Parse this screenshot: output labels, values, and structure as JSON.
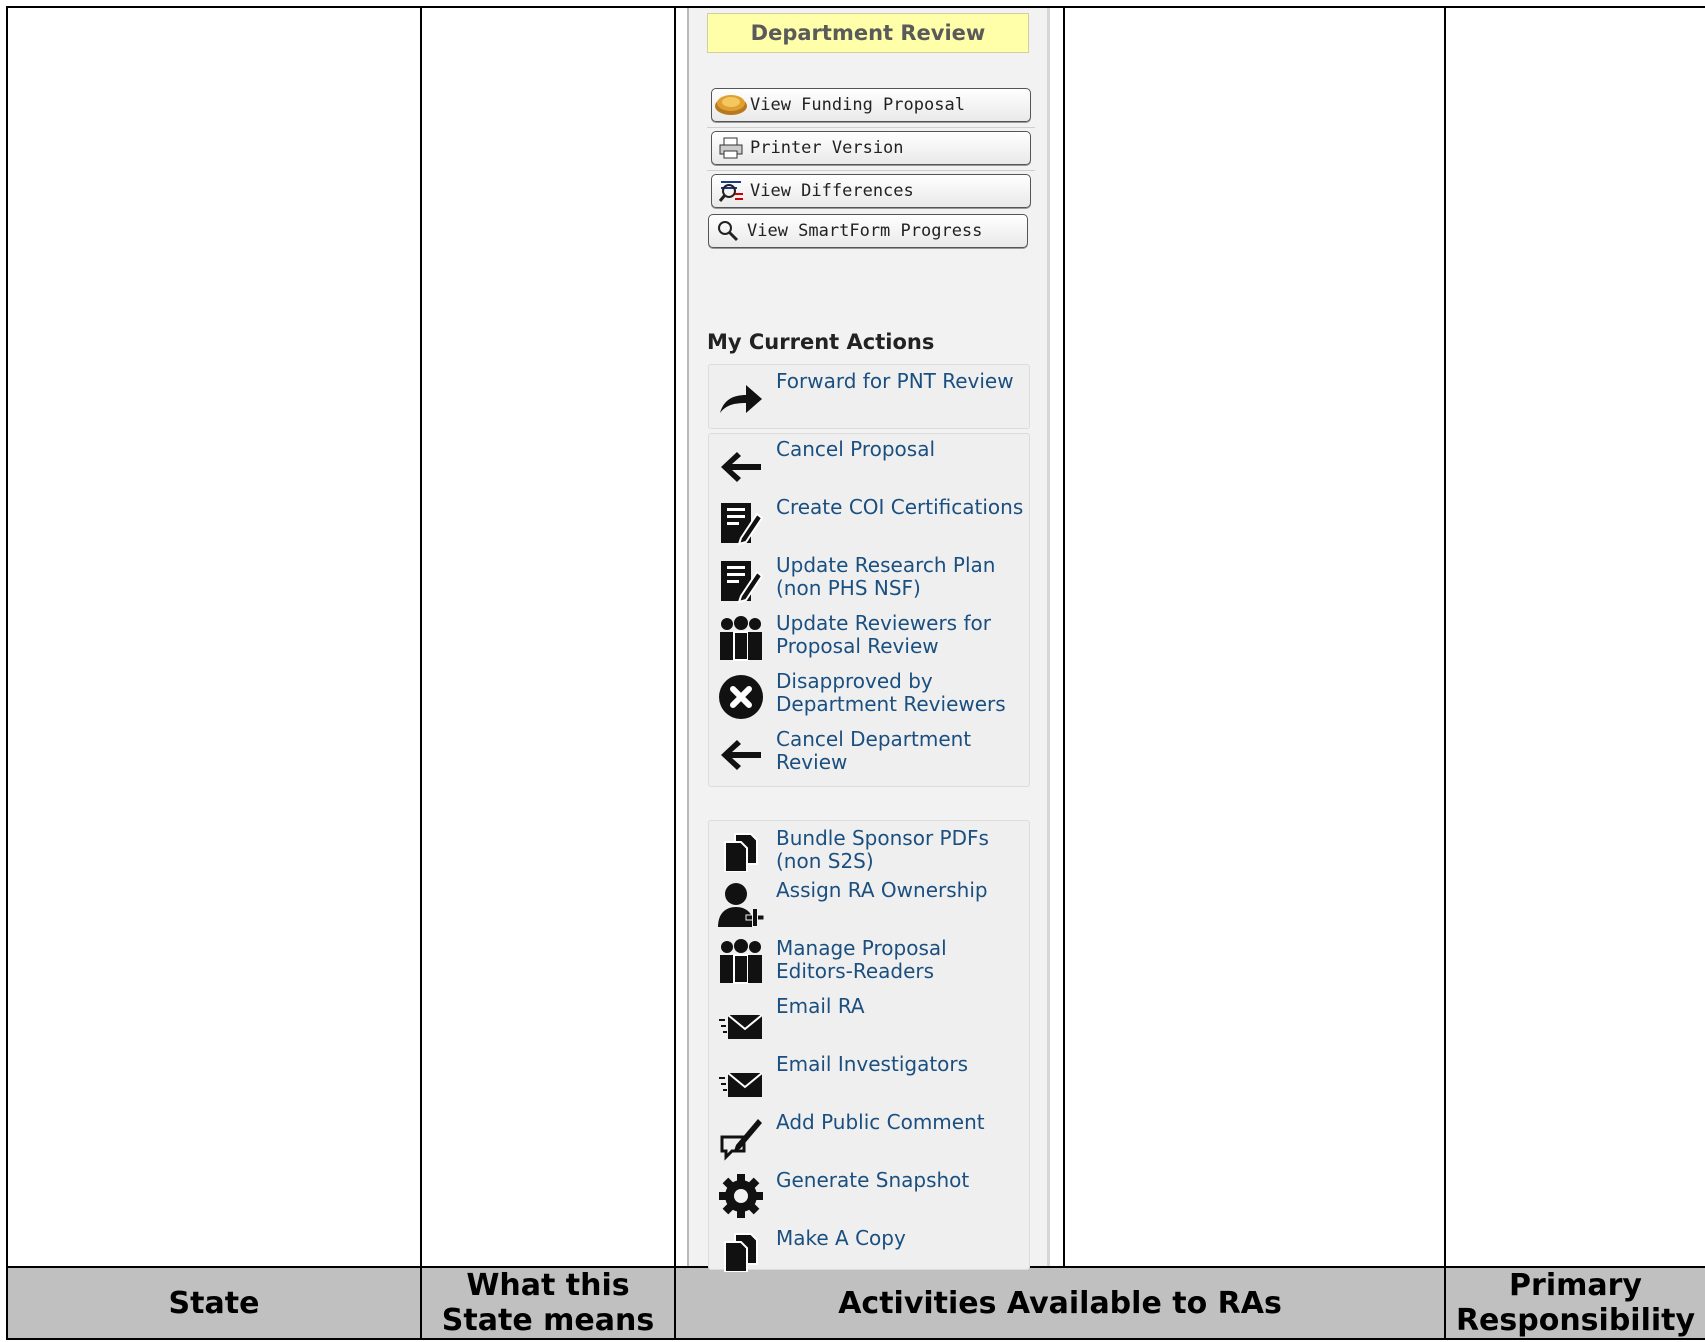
{
  "table": {
    "headers": {
      "state": "State",
      "what_means": "What this State means",
      "activities": "Activities Available to RAs",
      "primary": "Primary Responsibility"
    }
  },
  "panel": {
    "state_title": "Department Review",
    "buttons": [
      {
        "label": "View Funding Proposal",
        "icon": "coins-icon"
      },
      {
        "label": "Printer Version",
        "icon": "printer-icon"
      },
      {
        "label": "View Differences",
        "icon": "differences-icon"
      },
      {
        "label": "View SmartForm Progress",
        "icon": "magnifier-icon"
      }
    ],
    "section_title": "My Current Actions",
    "actions": [
      {
        "label": "Forward for PNT Review",
        "icon": "forward-arrow-icon"
      },
      {
        "label": "Cancel Proposal",
        "icon": "back-arrow-icon"
      },
      {
        "label": "Create COI Certifications",
        "icon": "form-edit-icon"
      },
      {
        "label": "Update Research Plan (non PHS NSF)",
        "icon": "form-edit-icon"
      },
      {
        "label": "Update Reviewers for Proposal Review",
        "icon": "people-group-icon"
      },
      {
        "label": "Disapproved by Department Reviewers",
        "icon": "x-circle-icon"
      },
      {
        "label": "Cancel Department Review",
        "icon": "back-arrow-icon"
      },
      {
        "label": "Bundle Sponsor PDFs (non S2S)",
        "icon": "documents-icon"
      },
      {
        "label": "Assign RA Ownership",
        "icon": "add-user-icon"
      },
      {
        "label": "Manage Proposal Editors-Readers",
        "icon": "people-group-icon"
      },
      {
        "label": "Email RA",
        "icon": "email-icon"
      },
      {
        "label": "Email Investigators",
        "icon": "email-icon"
      },
      {
        "label": "Add Public Comment",
        "icon": "comment-pen-icon"
      },
      {
        "label": "Generate Snapshot",
        "icon": "gear-icon"
      },
      {
        "label": "Make A Copy",
        "icon": "documents-icon"
      }
    ]
  },
  "colors": {
    "header_bg": "#c0c0c0",
    "link": "#1a4f80",
    "state_title_bg": "#ffffaa"
  }
}
